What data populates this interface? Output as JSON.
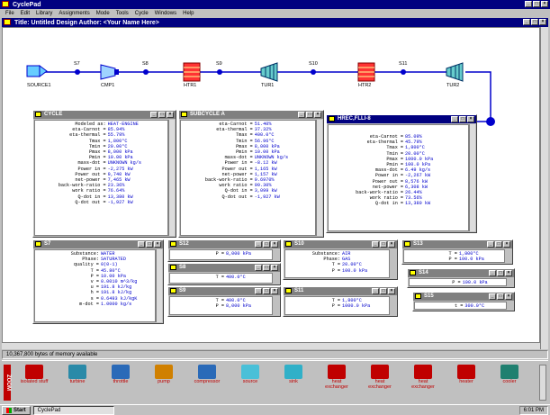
{
  "app": {
    "title": "CyclePad"
  },
  "menus": [
    "File",
    "Edit",
    "Library",
    "Assignments",
    "Mode",
    "Tools",
    "Cycle",
    "Windows",
    "Help"
  ],
  "design": {
    "title": "Title: Untitled Design  Author: <Your Name Here>"
  },
  "devices": [
    {
      "id": "SOURCE1",
      "kind": "source"
    },
    {
      "id": "CMP1",
      "kind": "compressor"
    },
    {
      "id": "HTR1",
      "kind": "heater"
    },
    {
      "id": "TUR1",
      "kind": "turbine"
    },
    {
      "id": "HTR2",
      "kind": "heater"
    },
    {
      "id": "TUR2",
      "kind": "turbine"
    }
  ],
  "streams": [
    "S7",
    "S8",
    "S9",
    "S10",
    "S11",
    "S12"
  ],
  "windows": {
    "cycle": {
      "title": "CYCLE",
      "rows": [
        [
          "Modeled as:",
          "HEAT-ENGINE"
        ],
        [
          "eta-Carnot =",
          "85.94%"
        ],
        [
          "eta-thermal =",
          "55.79%"
        ],
        [
          "Tmax =",
          "1,800°C"
        ],
        [
          "Tmin =",
          "20.00°C"
        ],
        [
          "Pmax =",
          "8,000 kPa"
        ],
        [
          "Pmin =",
          "10.00 kPa"
        ],
        [
          "mass-dot =",
          "UNKNOWN kg/s"
        ],
        [
          "Power in =",
          "-2,275 kW"
        ],
        [
          "Power out =",
          "9,740 kW"
        ],
        [
          "net-power =",
          "7,465 kW"
        ],
        [
          "back-work-ratio =",
          "23.36%"
        ],
        [
          "work ratio =",
          "76.64%"
        ],
        [
          "Q-dot in =",
          "13,380 kW"
        ],
        [
          "Q-dot out =",
          "-1,927 kW"
        ]
      ]
    },
    "subcycle": {
      "title": "SUBCYCLE A",
      "rows": [
        [
          "eta-Carnot =",
          "51.40%"
        ],
        [
          "eta-thermal =",
          "37.32%"
        ],
        [
          "Tmax =",
          "400.0°C"
        ],
        [
          "Tmin =",
          "56.96°C"
        ],
        [
          "Pmax =",
          "8,000 kPa"
        ],
        [
          "Pmin =",
          "10.00 kPa"
        ],
        [
          "mass-dot =",
          "UNKNOWN kg/s"
        ],
        [
          "Power in =",
          "-8.12 kW"
        ],
        [
          "Power out =",
          "1,165 kW"
        ],
        [
          "net-power =",
          "1,157 kW"
        ],
        [
          "back-work-ratio =",
          "0.6970%"
        ],
        [
          "work ratio =",
          "99.30%"
        ],
        [
          "Q-dot in =",
          "3,099 kW"
        ],
        [
          "Q-dot out =",
          "-1,927 kW"
        ]
      ]
    },
    "hrec": {
      "title": "HREC,FLLI-8",
      "rows": [
        [
          "eta-Carnot =",
          "85.09%"
        ],
        [
          "eta-thermal =",
          "45.79%"
        ],
        [
          "Tmax =",
          "1,800°C"
        ],
        [
          "Tmin =",
          "20.00°C"
        ],
        [
          "Pmax =",
          "1000.0 kPa"
        ],
        [
          "Pmin =",
          "100.0 kPa"
        ],
        [
          "mass-dot =",
          "6.49 kg/s"
        ],
        [
          "Power in =",
          "-2,267 kW"
        ],
        [
          "Power out =",
          "8,576 kW"
        ],
        [
          "net-power =",
          "6,308 kW"
        ],
        [
          "back-work-ratio =",
          "26.44%"
        ],
        [
          "work ratio =",
          "73.56%"
        ],
        [
          "Q-dot in =",
          "13,380 kW"
        ]
      ]
    },
    "s7": {
      "title": "S7",
      "rows": [
        [
          "Substance:",
          "WATER"
        ],
        [
          "Phase:",
          "SATURATED"
        ],
        [
          "quality =",
          "0(0-1)"
        ],
        [
          "T =",
          "45.80°C"
        ],
        [
          "P =",
          "10.00 kPa"
        ],
        [
          "v =",
          "0.0010 m^3/kg"
        ],
        [
          "u =",
          "191.8 kJ/kg"
        ],
        [
          "h =",
          "191.8 kJ/kg"
        ],
        [
          "s =",
          "0.6493 kJ/kgK"
        ],
        [
          "m-dot =",
          "1.0000 kg/s"
        ]
      ]
    },
    "s12": {
      "title": "S12",
      "rows": [
        [
          "P =",
          "8,000 kPa"
        ]
      ]
    },
    "s8": {
      "title": "S8",
      "rows": [
        [
          "T =",
          "400.0°C"
        ]
      ]
    },
    "s9": {
      "title": "S9",
      "rows": [
        [
          "T =",
          "400.0°C"
        ],
        [
          "P =",
          "8,000 kPa"
        ]
      ]
    },
    "s10": {
      "title": "S10",
      "rows": [
        [
          "Substance:",
          "AIR"
        ],
        [
          "Phase:",
          "GAS"
        ],
        [
          "T =",
          "20.00°C"
        ],
        [
          "P =",
          "100.0 kPa"
        ]
      ]
    },
    "s11": {
      "title": "S11",
      "rows": [
        [
          "T =",
          "1,800°C"
        ],
        [
          "P =",
          "1000.0 kPa"
        ]
      ]
    },
    "s13": {
      "title": "S13",
      "rows": [
        [
          "T =",
          "1,800°C"
        ],
        [
          "P =",
          "100.0 kPa"
        ]
      ]
    },
    "s14": {
      "title": "S14",
      "rows": [
        [
          "P =",
          "100.0 kPa"
        ]
      ]
    },
    "s15": {
      "title": "S15",
      "rows": [
        [
          "t =",
          "300.0°C"
        ]
      ]
    }
  },
  "status": {
    "memory": "10,367,800 bytes of memory available"
  },
  "toolbox": [
    "isolated stuff",
    "turbine",
    "throttle",
    "pump",
    "compressor",
    "source",
    "sink",
    "heat exchanger",
    "heat exchanger",
    "heat exchanger",
    "heater",
    "cooler"
  ],
  "taskbar": {
    "start": "Start",
    "task": "CyclePad",
    "clock": "6:01 PM"
  },
  "colors": {
    "titlebar": "#000080",
    "value": "#0000cc",
    "toolbox_label": "#c00000"
  }
}
